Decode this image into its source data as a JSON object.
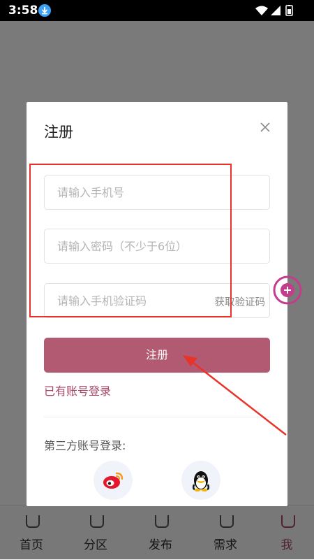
{
  "status_bar": {
    "time": "3:58"
  },
  "dialog": {
    "title": "注册",
    "phone_placeholder": "请输入手机号",
    "password_placeholder": "请输入密码（不少于6位）",
    "code_placeholder": "请输入手机验证码",
    "get_code_label": "获取验证码",
    "register_label": "注册",
    "login_link": "已有账号登录",
    "third_party_label": "第三方账号登录:"
  },
  "social_icons": [
    "weibo-icon",
    "qq-icon"
  ],
  "bottom_nav": [
    {
      "label": "首页"
    },
    {
      "label": "分区"
    },
    {
      "label": "发布"
    },
    {
      "label": "需求"
    },
    {
      "label": "我",
      "active": true
    }
  ],
  "colors": {
    "accent": "#b15a72",
    "link": "#a8486a",
    "annotation": "#e8332b",
    "status_icon": "#3da2f5"
  }
}
